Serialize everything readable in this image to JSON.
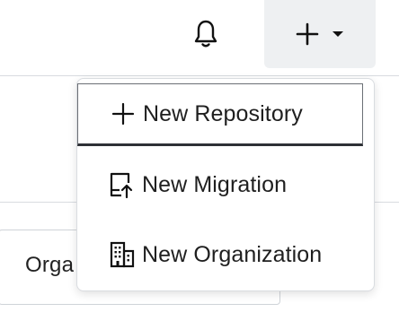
{
  "header": {
    "notifications_icon": "bell-icon",
    "create_button": {
      "icon": "plus-icon",
      "caret": "caret-down-icon"
    }
  },
  "background": {
    "partial_label": "Orga"
  },
  "menu": {
    "items": [
      {
        "icon": "plus-icon",
        "label": "New Repository",
        "focused": true
      },
      {
        "icon": "migration-icon",
        "label": "New Migration",
        "focused": false
      },
      {
        "icon": "building-icon",
        "label": "New Organization",
        "focused": false
      }
    ]
  },
  "colors": {
    "button_bg": "#eef0f2",
    "text": "#1f1f1f",
    "border": "#d9dce0"
  }
}
